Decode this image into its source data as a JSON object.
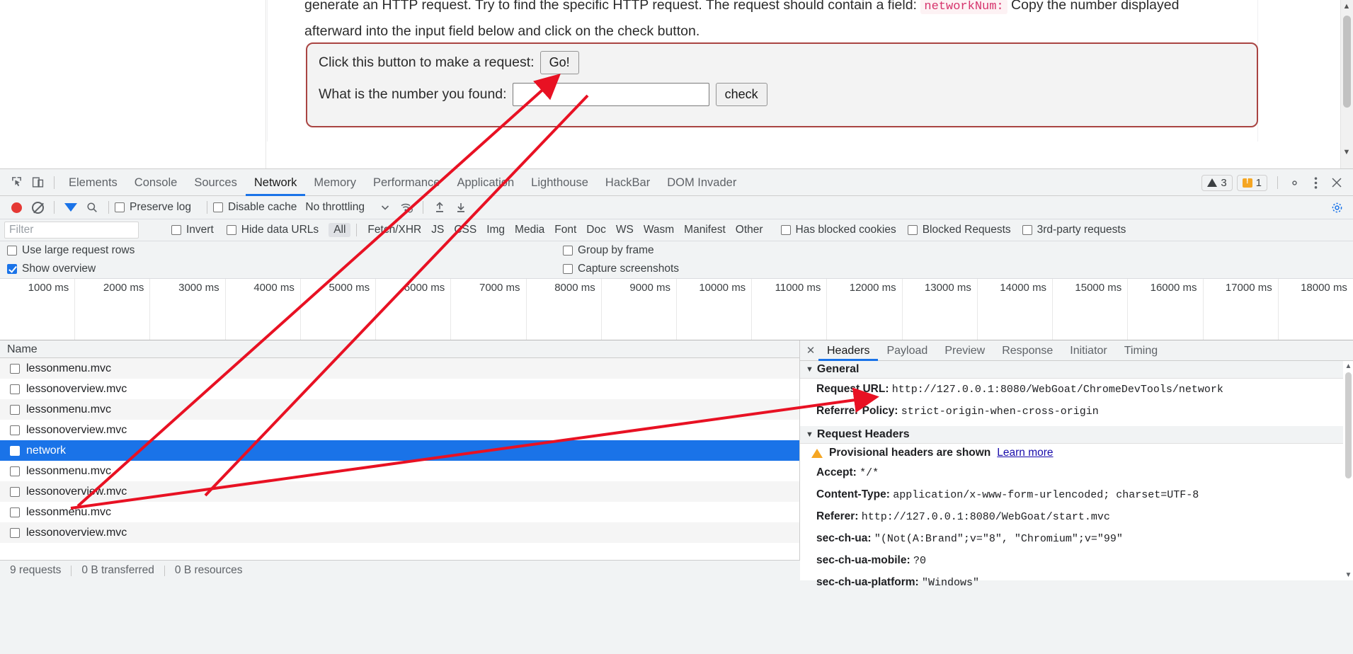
{
  "lesson": {
    "paragraph_line1_prefix": "generate an HTTP request. Try to find the specific HTTP request. The request should contain a field:",
    "paragraph_code": "networkNum:",
    "paragraph_line1_suffix": "Copy the number",
    "paragraph_line2": "displayed afterward into the input field below and click on the check button.",
    "row1_label": "Click this button to make a request:",
    "go_button": "Go!",
    "row2_label": "What is the number you found:",
    "answer_value": "",
    "answer_placeholder": "",
    "check_button": "check"
  },
  "devtools": {
    "tabs": [
      {
        "label": "Elements",
        "active": false
      },
      {
        "label": "Console",
        "active": false
      },
      {
        "label": "Sources",
        "active": false
      },
      {
        "label": "Network",
        "active": true
      },
      {
        "label": "Memory",
        "active": false
      },
      {
        "label": "Performance",
        "active": false
      },
      {
        "label": "Application",
        "active": false
      },
      {
        "label": "Lighthouse",
        "active": false
      },
      {
        "label": "HackBar",
        "active": false
      },
      {
        "label": "DOM Invader",
        "active": false
      }
    ],
    "badges": {
      "errors": "3",
      "warnings": "1"
    },
    "icons": {
      "inspect": "inspect-element-icon",
      "device": "device-toolbar-icon",
      "settings": "gear-icon",
      "more": "more-options-icon",
      "close": "close-icon"
    },
    "toolbar": {
      "record": "record-button",
      "clear": "clear-button",
      "filter": "filter-toggle",
      "search": "search-button",
      "preserve_log": "Preserve log",
      "preserve_log_checked": false,
      "disable_cache": "Disable cache",
      "disable_cache_checked": false,
      "throttling": "No throttling",
      "import_har": "import-har-icon",
      "export_har": "export-har-icon",
      "wifi": "network-conditions-icon"
    },
    "filter_bar": {
      "placeholder": "Filter",
      "value": "",
      "invert": "Invert",
      "invert_checked": false,
      "hide_data_urls": "Hide data URLs",
      "hide_data_urls_checked": false,
      "types": [
        "All",
        "Fetch/XHR",
        "JS",
        "CSS",
        "Img",
        "Media",
        "Font",
        "Doc",
        "WS",
        "Wasm",
        "Manifest",
        "Other"
      ],
      "active_type": "All",
      "has_blocked_cookies": "Has blocked cookies",
      "has_blocked_cookies_checked": false,
      "blocked_requests": "Blocked Requests",
      "blocked_requests_checked": false,
      "third_party": "3rd-party requests",
      "third_party_checked": false
    },
    "options": {
      "use_large_request_rows": "Use large request rows",
      "use_large_request_rows_checked": false,
      "show_overview": "Show overview",
      "show_overview_checked": true,
      "group_by_frame": "Group by frame",
      "group_by_frame_checked": false,
      "capture_screenshots": "Capture screenshots",
      "capture_screenshots_checked": false
    },
    "overview_ticks": [
      "1000 ms",
      "2000 ms",
      "3000 ms",
      "4000 ms",
      "5000 ms",
      "6000 ms",
      "7000 ms",
      "8000 ms",
      "9000 ms",
      "10000 ms",
      "11000 ms",
      "12000 ms",
      "13000 ms",
      "14000 ms",
      "15000 ms",
      "16000 ms",
      "17000 ms",
      "18000 ms"
    ],
    "requests": {
      "column_header": "Name",
      "rows": [
        {
          "name": "lessonmenu.mvc",
          "selected": false
        },
        {
          "name": "lessonoverview.mvc",
          "selected": false
        },
        {
          "name": "lessonmenu.mvc",
          "selected": false
        },
        {
          "name": "lessonoverview.mvc",
          "selected": false
        },
        {
          "name": "network",
          "selected": true
        },
        {
          "name": "lessonmenu.mvc",
          "selected": false
        },
        {
          "name": "lessonoverview.mvc",
          "selected": false
        },
        {
          "name": "lessonmenu.mvc",
          "selected": false
        },
        {
          "name": "lessonoverview.mvc",
          "selected": false
        }
      ]
    },
    "detail": {
      "tabs": [
        {
          "label": "Headers",
          "active": true
        },
        {
          "label": "Payload",
          "active": false
        },
        {
          "label": "Preview",
          "active": false
        },
        {
          "label": "Response",
          "active": false
        },
        {
          "label": "Initiator",
          "active": false
        },
        {
          "label": "Timing",
          "active": false
        }
      ],
      "general_title": "General",
      "general": [
        {
          "key": "Request URL:",
          "value": "http://127.0.0.1:8080/WebGoat/ChromeDevTools/network"
        },
        {
          "key": "Referrer Policy:",
          "value": "strict-origin-when-cross-origin"
        }
      ],
      "request_headers_title": "Request Headers",
      "provisional_note": "Provisional headers are shown",
      "learn_more": "Learn more",
      "request_headers": [
        {
          "key": "Accept:",
          "value": "*/*"
        },
        {
          "key": "Content-Type:",
          "value": "application/x-www-form-urlencoded; charset=UTF-8"
        },
        {
          "key": "Referer:",
          "value": "http://127.0.0.1:8080/WebGoat/start.mvc"
        },
        {
          "key": "sec-ch-ua:",
          "value": "\"(Not(A:Brand\";v=\"8\", \"Chromium\";v=\"99\""
        },
        {
          "key": "sec-ch-ua-mobile:",
          "value": "?0"
        },
        {
          "key": "sec-ch-ua-platform:",
          "value": "\"Windows\""
        }
      ]
    },
    "statusbar": {
      "requests": "9 requests",
      "transferred": "0 B transferred",
      "resources": "0 B resources"
    }
  },
  "colors": {
    "accent": "#1a73e8",
    "annotation": "#e81123",
    "warning": "#f5a623",
    "record": "#e53935",
    "code_pink": "#d6336c",
    "attack_border": "#a94442"
  }
}
